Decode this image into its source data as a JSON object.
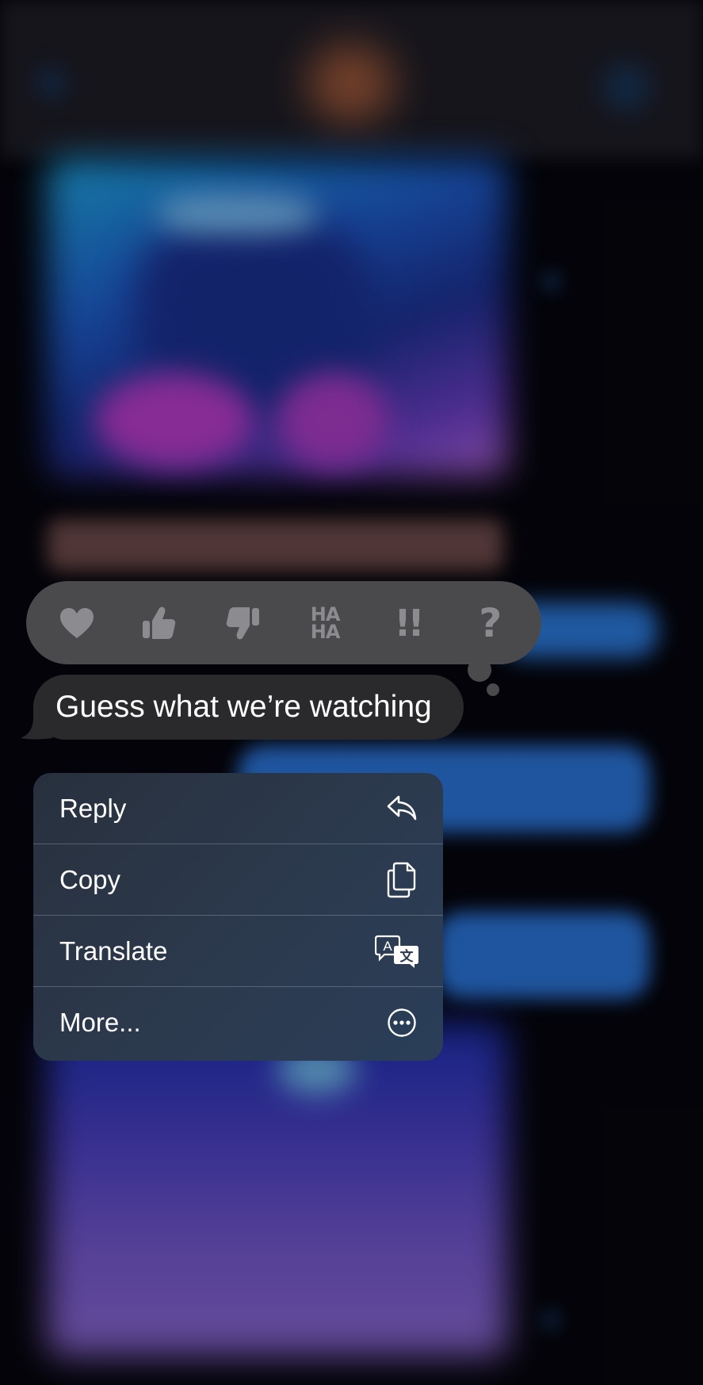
{
  "tapbacks": [
    {
      "name": "heart",
      "icon": "heart-icon"
    },
    {
      "name": "thumbs-up",
      "icon": "thumbs-up-icon"
    },
    {
      "name": "thumbs-down",
      "icon": "thumbs-down-icon"
    },
    {
      "name": "haha",
      "icon": "haha-icon",
      "text_top": "HA",
      "text_bottom": "HA"
    },
    {
      "name": "emphasize",
      "icon": "double-exclamation-icon",
      "text": "!!"
    },
    {
      "name": "question",
      "icon": "question-mark-icon",
      "text": "?"
    }
  ],
  "message": {
    "text": "Guess what we’re watching"
  },
  "menu": {
    "items": [
      {
        "label": "Reply",
        "icon": "reply-icon"
      },
      {
        "label": "Copy",
        "icon": "copy-icon"
      },
      {
        "label": "Translate",
        "icon": "translate-icon"
      },
      {
        "label": "More...",
        "icon": "more-icon"
      }
    ]
  },
  "colors": {
    "tapback_bg": "#4a4a4c",
    "tapback_icon": "#8c8c90",
    "bubble_bg": "#2a2a2d",
    "menu_bg": "#2c3a4e",
    "text": "#ffffff"
  }
}
